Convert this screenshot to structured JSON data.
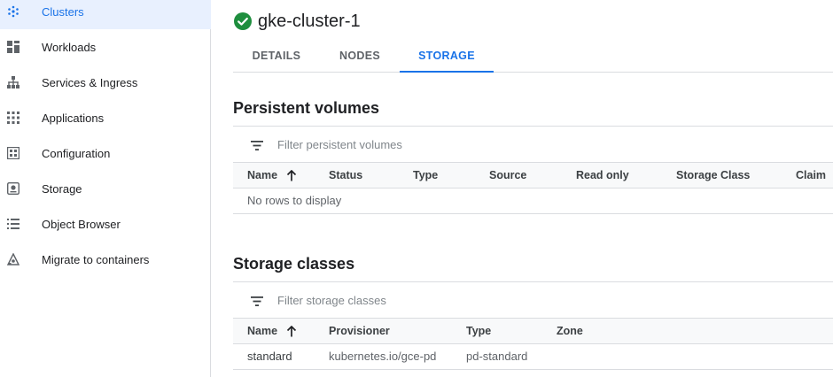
{
  "sidebar": {
    "items": [
      {
        "label": "Clusters",
        "icon": "clusters-icon",
        "active": true
      },
      {
        "label": "Workloads",
        "icon": "workloads-icon",
        "active": false
      },
      {
        "label": "Services & Ingress",
        "icon": "services-icon",
        "active": false
      },
      {
        "label": "Applications",
        "icon": "applications-icon",
        "active": false
      },
      {
        "label": "Configuration",
        "icon": "configuration-icon",
        "active": false
      },
      {
        "label": "Storage",
        "icon": "storage-icon",
        "active": false
      },
      {
        "label": "Object Browser",
        "icon": "object-browser-icon",
        "active": false
      },
      {
        "label": "Migrate to containers",
        "icon": "migrate-icon",
        "active": false
      }
    ]
  },
  "header": {
    "title": "gke-cluster-1",
    "status_icon": "check-circle-icon",
    "status_color": "#1e8e3e"
  },
  "tabs": [
    {
      "label": "DETAILS",
      "active": false
    },
    {
      "label": "NODES",
      "active": false
    },
    {
      "label": "STORAGE",
      "active": true
    }
  ],
  "persistent_volumes": {
    "title": "Persistent volumes",
    "filter_placeholder": "Filter persistent volumes",
    "columns": [
      "Name",
      "Status",
      "Type",
      "Source",
      "Read only",
      "Storage Class",
      "Claim"
    ],
    "empty_text": "No rows to display"
  },
  "storage_classes": {
    "title": "Storage classes",
    "filter_placeholder": "Filter storage classes",
    "columns": [
      "Name",
      "Provisioner",
      "Type",
      "Zone"
    ],
    "rows": [
      {
        "name": "standard",
        "provisioner": "kubernetes.io/gce-pd",
        "type": "pd-standard",
        "zone": ""
      }
    ]
  },
  "colors": {
    "accent": "#1a73e8",
    "active_nav_bg": "#e8f0fe",
    "success": "#1e8e3e"
  }
}
